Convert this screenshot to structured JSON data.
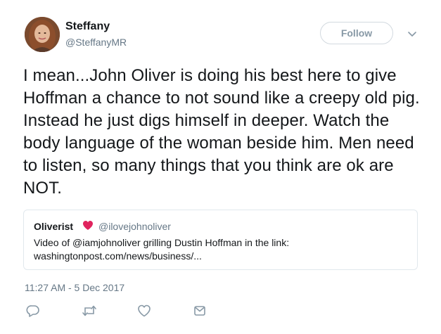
{
  "author": {
    "name": "Steffany",
    "handle": "@SteffanyMR",
    "avatar_icon": "avatar-photo"
  },
  "follow_button": {
    "label": "Follow"
  },
  "menu": {
    "icon": "chevron-down-icon"
  },
  "tweet_text": "I mean...John Oliver is doing his best here to give Hoffman a chance to not sound like a creepy old pig. Instead he just digs himself in deeper. Watch the body language of the woman beside him. Men need to listen, so many things that you think are ok are NOT.",
  "quoted_tweet": {
    "name": "Oliverist",
    "emoji_icon": "red-heart-icon",
    "handle": "@ilovejohnoliver",
    "line1": "Video of @iamjohnoliver grilling Dustin Hoffman in the link:",
    "line2": "washingtonpost.com/news/business/..."
  },
  "timestamp": "11:27 AM - 5 Dec 2017",
  "actions": [
    "reply-icon",
    "retweet-icon",
    "like-icon",
    "message-icon"
  ],
  "colors": {
    "text": "#14171a",
    "secondary": "#657786",
    "icon": "#8899a6",
    "border": "#e1e8ed",
    "heart": "#e0245e"
  }
}
